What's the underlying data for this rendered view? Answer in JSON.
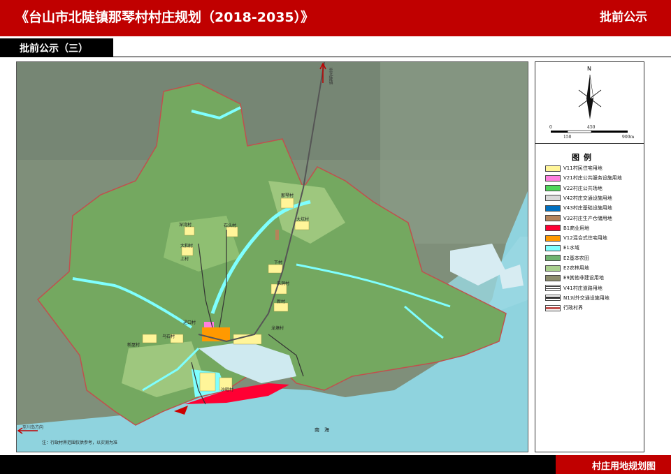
{
  "header": {
    "title": "《台山市北陡镇那琴村村庄规划（2018-2035）》",
    "right_label": "批前公示"
  },
  "subtab": {
    "label": "批前公示（三）"
  },
  "map": {
    "village_labels": [
      "那琴村",
      "大坑村",
      "石头村",
      "深湾村",
      "大和村",
      "上村",
      "下村",
      "朱洞村",
      "新村",
      "龙塘村",
      "迳口村",
      "乌石村",
      "新屋村",
      "沙咀村"
    ],
    "sea_label": "南　海",
    "north_road_label": "至北陡镇",
    "west_road_label": "至川岛方向",
    "note": "注：行政村界范围仅供参考，以实测为准"
  },
  "compass": {
    "north": "N",
    "scale_ticks": [
      "0",
      "150",
      "450",
      "900m"
    ]
  },
  "legend": {
    "title": "图例",
    "items": [
      {
        "label": "V11村民住宅用地",
        "color": "#fff599"
      },
      {
        "label": "V21村庄公共服务设施用地",
        "color": "#ff7fdf"
      },
      {
        "label": "V22村庄公共场地",
        "color": "#4fd65a"
      },
      {
        "label": "V42村庄交通设施用地",
        "color": "#d9d9d9"
      },
      {
        "label": "V43村庄基础设施用地",
        "color": "#0070c0"
      },
      {
        "label": "V32村庄生产仓储用地",
        "color": "#b5835a"
      },
      {
        "label": "B1商业用地",
        "color": "#ff0033"
      },
      {
        "label": "V12混合式住宅用地",
        "color": "#ff9900"
      },
      {
        "label": "E1水域",
        "color": "#7fffff"
      },
      {
        "label": "E2基本农田",
        "color": "#6fb36f"
      },
      {
        "label": "E2农林用地",
        "color": "#a9d08e"
      },
      {
        "label": "E9其他非建设用地",
        "color": "#8c8c6c"
      },
      {
        "label": "V41村庄道路用地",
        "color": "#ffffff"
      },
      {
        "label": "N1对外交通设施用地",
        "color": "#555555"
      },
      {
        "label": "行政村界",
        "color": "#c0504d"
      }
    ]
  },
  "footer": {
    "label": "村庄用地规划图"
  }
}
